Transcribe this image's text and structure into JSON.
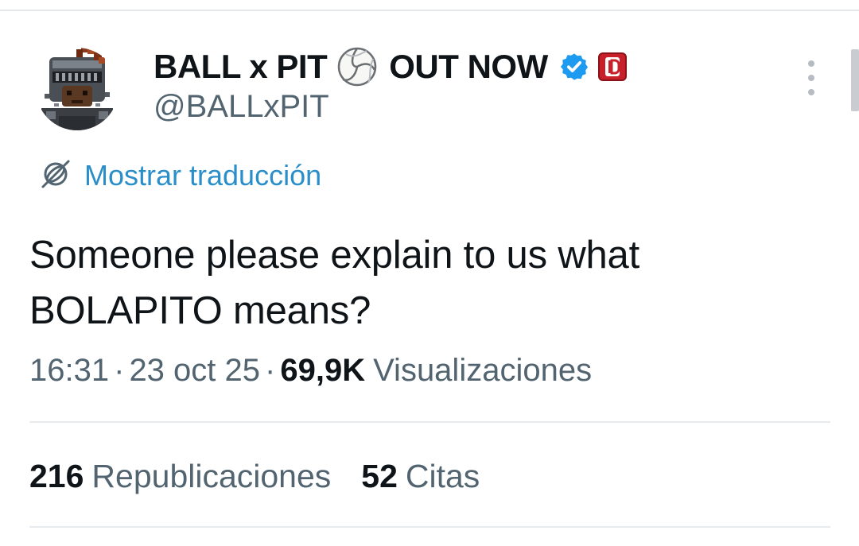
{
  "tweet": {
    "author": {
      "name_part1": "BALL x PIT",
      "name_part2": "OUT NOW",
      "handle": "@BALLxPIT",
      "name_emoji": "volleyball-icon",
      "verified_icon": "verified-badge-icon",
      "affiliate_badge": "affiliate-badge-icon"
    },
    "translate_label": "Mostrar traducción",
    "text_line1": "Someone please explain to us what",
    "text_line2": "BOLAPITO means?",
    "time": "16:31",
    "date": "23 oct 25",
    "views_count": "69,9K",
    "views_label": "Visualizaciones",
    "separator": "·",
    "stats": [
      {
        "count": "216",
        "label": "Republicaciones"
      },
      {
        "count": "52",
        "label": "Citas"
      }
    ]
  },
  "colors": {
    "text_primary": "#0f1419",
    "text_secondary": "#536471",
    "link": "#2a8ec8",
    "verified": "#1d9bf0",
    "badge_red": "#c8202a",
    "divider": "#e8ebed"
  }
}
